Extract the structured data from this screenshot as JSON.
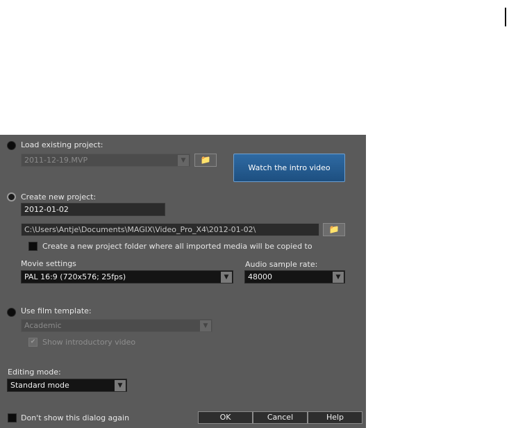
{
  "load_project": {
    "label": "Load existing project:",
    "value": "2011-12-19.MVP",
    "dropdown_icon": "▼",
    "folder_icon": "📁"
  },
  "intro_video_label": "Watch the intro video",
  "create_project": {
    "label": "Create new project:",
    "name": "2012-01-02",
    "path": "C:\\Users\\Antje\\Documents\\MAGIX\\Video_Pro_X4\\2012-01-02\\",
    "folder_icon": "📁",
    "new_folder_option": "Create a new project folder where all imported media will be copied to"
  },
  "movie_settings": {
    "label": "Movie settings",
    "value": "PAL 16:9 (720x576; 25fps)",
    "dropdown_icon": "▼"
  },
  "audio_sample_rate": {
    "label": "Audio sample rate:",
    "value": "48000",
    "dropdown_icon": "▼"
  },
  "film_template": {
    "label": "Use film template:",
    "value": "Academic",
    "dropdown_icon": "▼",
    "show_intro_label": "Show introductory video",
    "show_intro_check": "✔"
  },
  "editing_mode": {
    "label": "Editing mode:",
    "value": "Standard mode",
    "dropdown_icon": "▼"
  },
  "footer": {
    "dont_show_label": "Don't show this dialog again",
    "ok": "OK",
    "cancel": "Cancel",
    "help": "Help"
  }
}
